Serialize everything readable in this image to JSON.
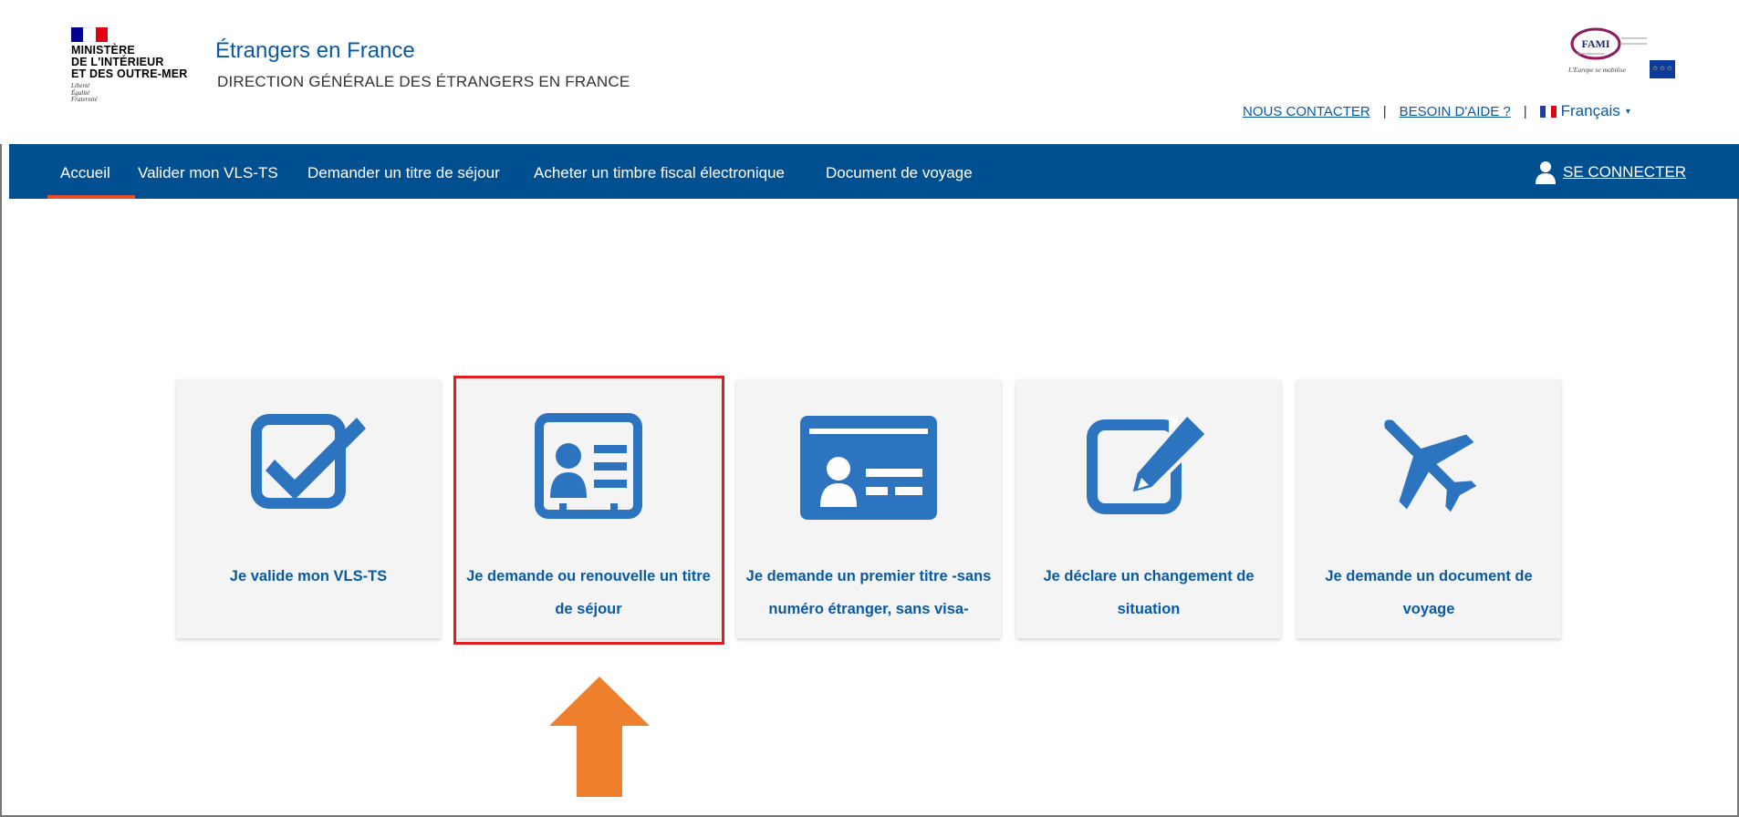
{
  "header": {
    "ministry": "MINISTÈRE\nDE L'INTÉRIEUR\nET DES OUTRE-MER",
    "motto": "Liberté\nÉgalité\nFraternité",
    "site_title": "Étrangers en France",
    "site_subtitle": "DIRECTION GÉNÉRALE DES ÉTRANGERS EN FRANCE",
    "fami_logo": "FAMI",
    "fami_tagline": "L'Europe se mobilise",
    "contact_link": "NOUS CONTACTER",
    "help_link": "BESOIN D'AIDE ?",
    "separator": "|",
    "language": "Français"
  },
  "nav": {
    "items": [
      {
        "label": "Accueil"
      },
      {
        "label": "Valider mon VLS-TS"
      },
      {
        "label": "Demander un titre de séjour"
      },
      {
        "label": "Acheter un timbre fiscal électronique"
      },
      {
        "label": "Document de voyage"
      }
    ],
    "login": "SE CONNECTER"
  },
  "cards": [
    {
      "label": "Je valide mon VLS-TS",
      "icon": "checkbox-icon"
    },
    {
      "label": "Je demande ou renouvelle un titre de séjour",
      "icon": "id-badge-icon"
    },
    {
      "label": "Je demande un premier titre -sans numéro étranger, sans visa-",
      "icon": "id-card-icon"
    },
    {
      "label": "Je déclare un changement de situation",
      "icon": "edit-icon"
    },
    {
      "label": "Je demande un document de voyage",
      "icon": "plane-icon"
    }
  ],
  "colors": {
    "brand_blue": "#004f91",
    "link_blue": "#0a5aa3",
    "icon_blue": "#2c74c0",
    "active_underline": "#e8502d",
    "highlight_red": "#e31d1d",
    "arrow_orange": "#ee7f2d"
  }
}
